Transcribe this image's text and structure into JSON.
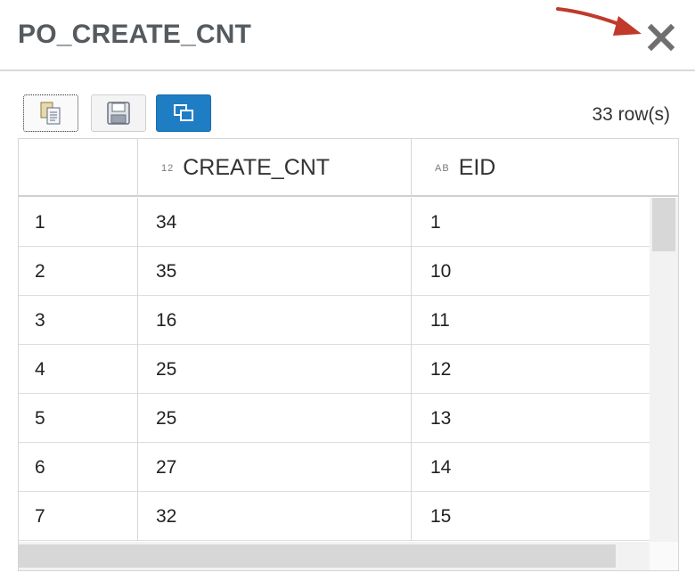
{
  "dialog": {
    "title": "PO_CREATE_CNT",
    "close_icon": "close-icon",
    "annotation_color": "#c0392b"
  },
  "toolbar": {
    "buttons": [
      {
        "icon": "copy-icon"
      },
      {
        "icon": "save-icon"
      },
      {
        "icon": "window-icon",
        "color": "#1f7dc4"
      }
    ],
    "row_count": "33 row(s)"
  },
  "table": {
    "columns": [
      {
        "label": ""
      },
      {
        "type_tag": "12",
        "label": "CREATE_CNT"
      },
      {
        "type_tag": "AB",
        "label": "EID"
      }
    ],
    "rows": [
      [
        "1",
        "34",
        "1"
      ],
      [
        "2",
        "35",
        "10"
      ],
      [
        "3",
        "16",
        "11"
      ],
      [
        "4",
        "25",
        "12"
      ],
      [
        "5",
        "25",
        "13"
      ],
      [
        "6",
        "27",
        "14"
      ],
      [
        "7",
        "32",
        "15"
      ]
    ]
  }
}
